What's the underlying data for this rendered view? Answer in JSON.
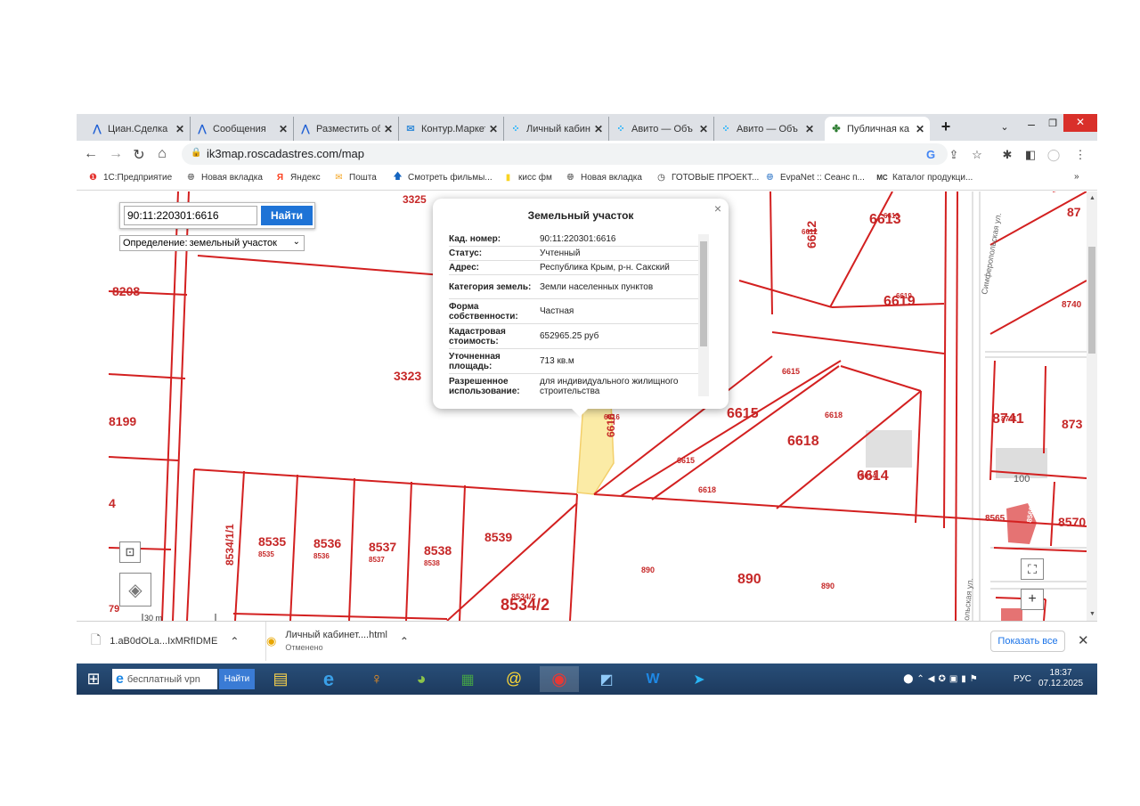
{
  "tabs": [
    {
      "title": "Циан.Сделка",
      "icon": "cian-icon",
      "color": "#1f5fd4",
      "active": false
    },
    {
      "title": "Сообщения",
      "icon": "cian-icon",
      "color": "#1f5fd4",
      "active": false
    },
    {
      "title": "Разместить об",
      "icon": "cian-icon",
      "color": "#1f5fd4",
      "active": false
    },
    {
      "title": "Контур.Маркет",
      "icon": "mail-icon",
      "color": "#3c8fd8",
      "active": false
    },
    {
      "title": "Личный кабин",
      "icon": "avito-icon",
      "color": "#00aaff",
      "active": false
    },
    {
      "title": "Авито — Объ",
      "icon": "avito-icon",
      "color": "#00aaff",
      "active": false
    },
    {
      "title": "Авито — Объ",
      "icon": "avito-icon",
      "color": "#00aaff",
      "active": false
    },
    {
      "title": "Публичная ка",
      "icon": "pkk-icon",
      "color": "#2e7d32",
      "active": true
    }
  ],
  "address": {
    "url": "ik3map.roscadastres.com/map"
  },
  "bookmarks": [
    "1С:Предприятие",
    "Новая вкладка",
    "Яндекс",
    "Пошта",
    "Смотреть фильмы...",
    "кисс фм",
    "Новая вкладка",
    "ГОТОВЫЕ ПРОЕКТ...",
    "EvpaNet :: Сеанс п...",
    "Каталог продукци..."
  ],
  "search": {
    "value": "90:11:220301:6616",
    "button": "Найти"
  },
  "definition": {
    "label": "Определение:",
    "value": "земельный участок"
  },
  "popup": {
    "title": "Земельный участок",
    "rows": [
      {
        "k": "Кад. номер:",
        "v": "90:11:220301:6616"
      },
      {
        "k": "Статус:",
        "v": "Учтенный"
      },
      {
        "k": "Адрес:",
        "v": "Республика Крым, р-н. Сакский"
      },
      {
        "k": "Категория земель:",
        "v": "Земли населенных пунктов"
      },
      {
        "k": "Форма собственности:",
        "v": "Частная"
      },
      {
        "k": "Кадастровая стоимость:",
        "v": "652965.25 руб"
      },
      {
        "k": "Уточненная площадь:",
        "v": "713 кв.м"
      },
      {
        "k": "Разрешенное использование:",
        "v": "для индивидуального жилищного строительства"
      }
    ]
  },
  "map_labels": {
    "l3325": "3325",
    "l8208": "8208",
    "l3323": "3323",
    "l8199": "8199",
    "l4": "4",
    "l79": "79",
    "l8534_1": "8534/1/1",
    "l8535": "8535",
    "l8535s": "8535",
    "l8536": "8536",
    "l8536s": "8536",
    "l8537": "8537",
    "l8537s": "8537",
    "l8538": "8538",
    "l8538s": "8538",
    "l8539": "8539",
    "l8534_2": "8534/2",
    "l8534_2s": "8534/2",
    "l6616s": "6616",
    "l6616": "6616",
    "l6612": "6612",
    "l6612s": "6612",
    "l6613": "6613",
    "l6613s": "6613",
    "l6619": "6619",
    "l6619s": "6619",
    "l6615a": "6615",
    "l6615b": "6615",
    "l6615c": "6615",
    "l6618a": "6618",
    "l6618b": "6618",
    "l6618c": "6618",
    "l6614": "6614",
    "l6614s": "6614",
    "l890a": "890",
    "l890b": "890",
    "l890c": "890",
    "l8741": "8741",
    "l8741s": "8741",
    "l87": "87",
    "l8740": "8740",
    "l873": "873",
    "l8565": "8565",
    "l8570": "8570",
    "l100": "100",
    "l8566": "8566",
    "street1": "Симферопольская ул.",
    "street2": "ольская ул.",
    "scale": "30 m"
  },
  "downloads": [
    {
      "name": "1.aB0dOLa...IxMRfIDME",
      "status": ""
    },
    {
      "name": "Личный кабинет....html",
      "status": "Отменено"
    }
  ],
  "show_all": "Показать все",
  "taskbar": {
    "search": "бесплатный vpn",
    "search_btn": "Найти",
    "lang": "РУС",
    "time": "18:37",
    "date": "07.12.2025"
  }
}
